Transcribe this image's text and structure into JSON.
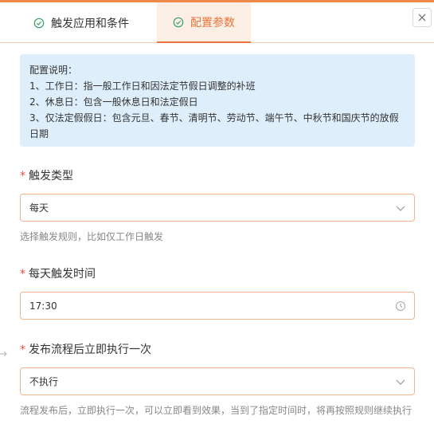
{
  "tabs": [
    {
      "label": "触发应用和条件"
    },
    {
      "label": "配置参数"
    }
  ],
  "info": {
    "title": "配置说明：",
    "line1": "1、工作日：指一般工作日和因法定节假日调整的补班",
    "line2": "2、休息日：包含一般休息日和法定假日",
    "line3": "3、仅法定假假日：包含元旦、春节、清明节、劳动节、端午节、中秋节和国庆节的放假日期"
  },
  "trigger_type": {
    "required_mark": "*",
    "label": "触发类型",
    "value": "每天",
    "hint": "选择触发规则，比如仅工作日触发"
  },
  "trigger_time": {
    "required_mark": "*",
    "label": "每天触发时间",
    "value": "17:30"
  },
  "run_once": {
    "required_mark": "*",
    "label": "发布流程后立即执行一次",
    "value": "不执行",
    "hint": "流程发布后，立即执行一次，可以立即看到效果，当到了指定时间时，将再按照规则继续执行"
  },
  "colors": {
    "accent": "#e8743b",
    "info_bg": "#dfeefb",
    "required": "#f04b4b"
  }
}
